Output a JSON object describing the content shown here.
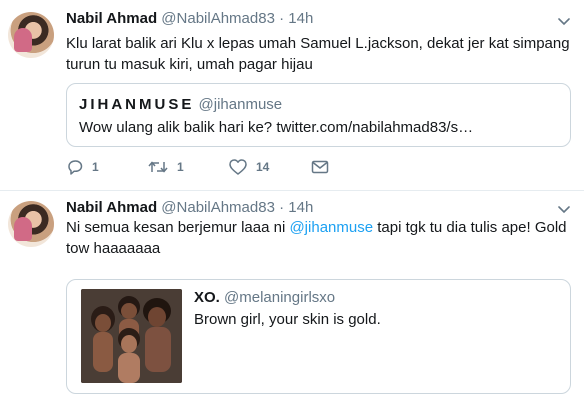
{
  "tweets": [
    {
      "name": "Nabil Ahmad",
      "handle": "@NabilAhmad83",
      "separator": "·",
      "time": "14h",
      "text": "Klu larat balik ari Klu x lepas umah Samuel L.jackson, dekat jer kat simpang turun tu masuk kiri, umah pagar hijau",
      "quote": {
        "name": "JIHANMUSE",
        "handle": "@jihanmuse",
        "text": "Wow ulang alik balik hari ke? twitter.com/nabilahmad83/s…"
      },
      "actions": {
        "replies": "1",
        "retweets": "1",
        "likes": "14"
      }
    },
    {
      "name": "Nabil Ahmad",
      "handle": "@NabilAhmad83",
      "separator": "·",
      "time": "14h",
      "text_before": "Ni semua kesan berjemur laaa ni ",
      "mention": "@jihanmuse",
      "text_after": " tapi tgk tu dia tulis ape! Gold tow haaaaaaa",
      "quote": {
        "name": "XO.",
        "handle": "@melaningirlsxo",
        "text": "Brown girl, your skin is gold."
      }
    }
  ],
  "colors": {
    "link": "#1da1f2",
    "secondary": "#657786",
    "border": "#e6ecf0"
  }
}
